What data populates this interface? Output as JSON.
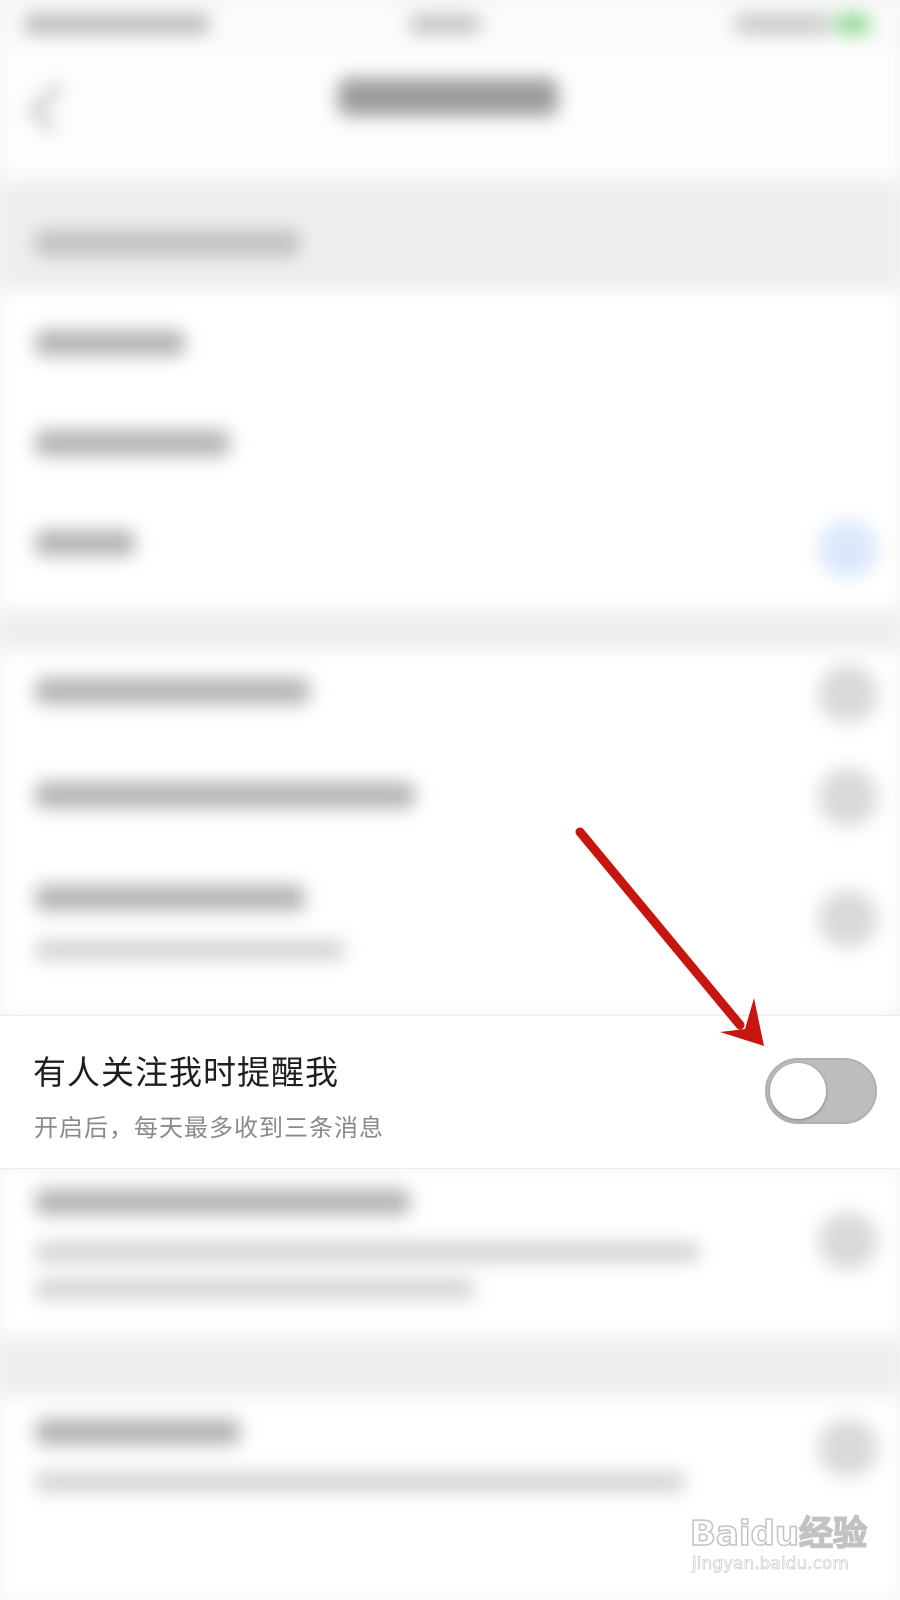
{
  "setting": {
    "title": "有人关注我时提醒我",
    "subtitle": "开启后，每天最多收到三条消息",
    "enabled": false
  },
  "watermark": {
    "brand": "Baidu经验",
    "url": "jingyan.baidu.com"
  },
  "colors": {
    "annotation_arrow": "#c8150f",
    "toggle_off_track": "#bdbdbd",
    "toggle_knob": "#ffffff"
  },
  "icons": {
    "toggle": "toggle-switch-off",
    "annotation": "red-arrow"
  }
}
